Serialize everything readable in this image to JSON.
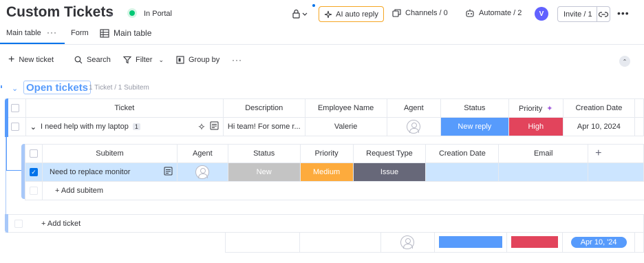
{
  "board": {
    "title": "Custom Tickets",
    "portal_status": "In Portal"
  },
  "header": {
    "ai_label": "AI auto reply",
    "channels_label": "Channels / 0",
    "automate_label": "Automate / 2",
    "avatar_initial": "V",
    "invite_label": "Invite / 1"
  },
  "tabs": [
    {
      "label": "Main table"
    },
    {
      "label": "Form"
    },
    {
      "label": "Main table"
    }
  ],
  "toolbar": {
    "new_ticket": "New ticket",
    "search": "Search",
    "filter": "Filter",
    "group_by": "Group by"
  },
  "group": {
    "title": "Open tickets",
    "count": "1 Ticket / 1 Subitem",
    "color": "#579bfc"
  },
  "main_table": {
    "headers": [
      "Ticket",
      "Description",
      "Employee Name",
      "Agent",
      "Status",
      "Priority",
      "Creation Date"
    ],
    "row": {
      "ticket": "I need help with my laptop",
      "subitem_count": "1",
      "description": "Hi team! For some r...",
      "employee": "Valerie",
      "status": "New reply",
      "priority": "High",
      "creation_date": "Apr 10, 2024"
    },
    "add_label": "+ Add ticket"
  },
  "subitems": {
    "headers": [
      "Subitem",
      "Agent",
      "Status",
      "Priority",
      "Request Type",
      "Creation Date",
      "Email"
    ],
    "row": {
      "name": "Need to replace monitor",
      "status": "New",
      "priority": "Medium",
      "request_type": "Issue"
    },
    "add_label": "+ Add subitem"
  },
  "summary": {
    "date_range": "Apr 10, '24"
  },
  "colors": {
    "new_reply": "#579bfc",
    "high": "#e2445c",
    "medium": "#fdab3d",
    "new": "#c4c4c4",
    "issue": "#676879",
    "accent": "#0073ea"
  }
}
